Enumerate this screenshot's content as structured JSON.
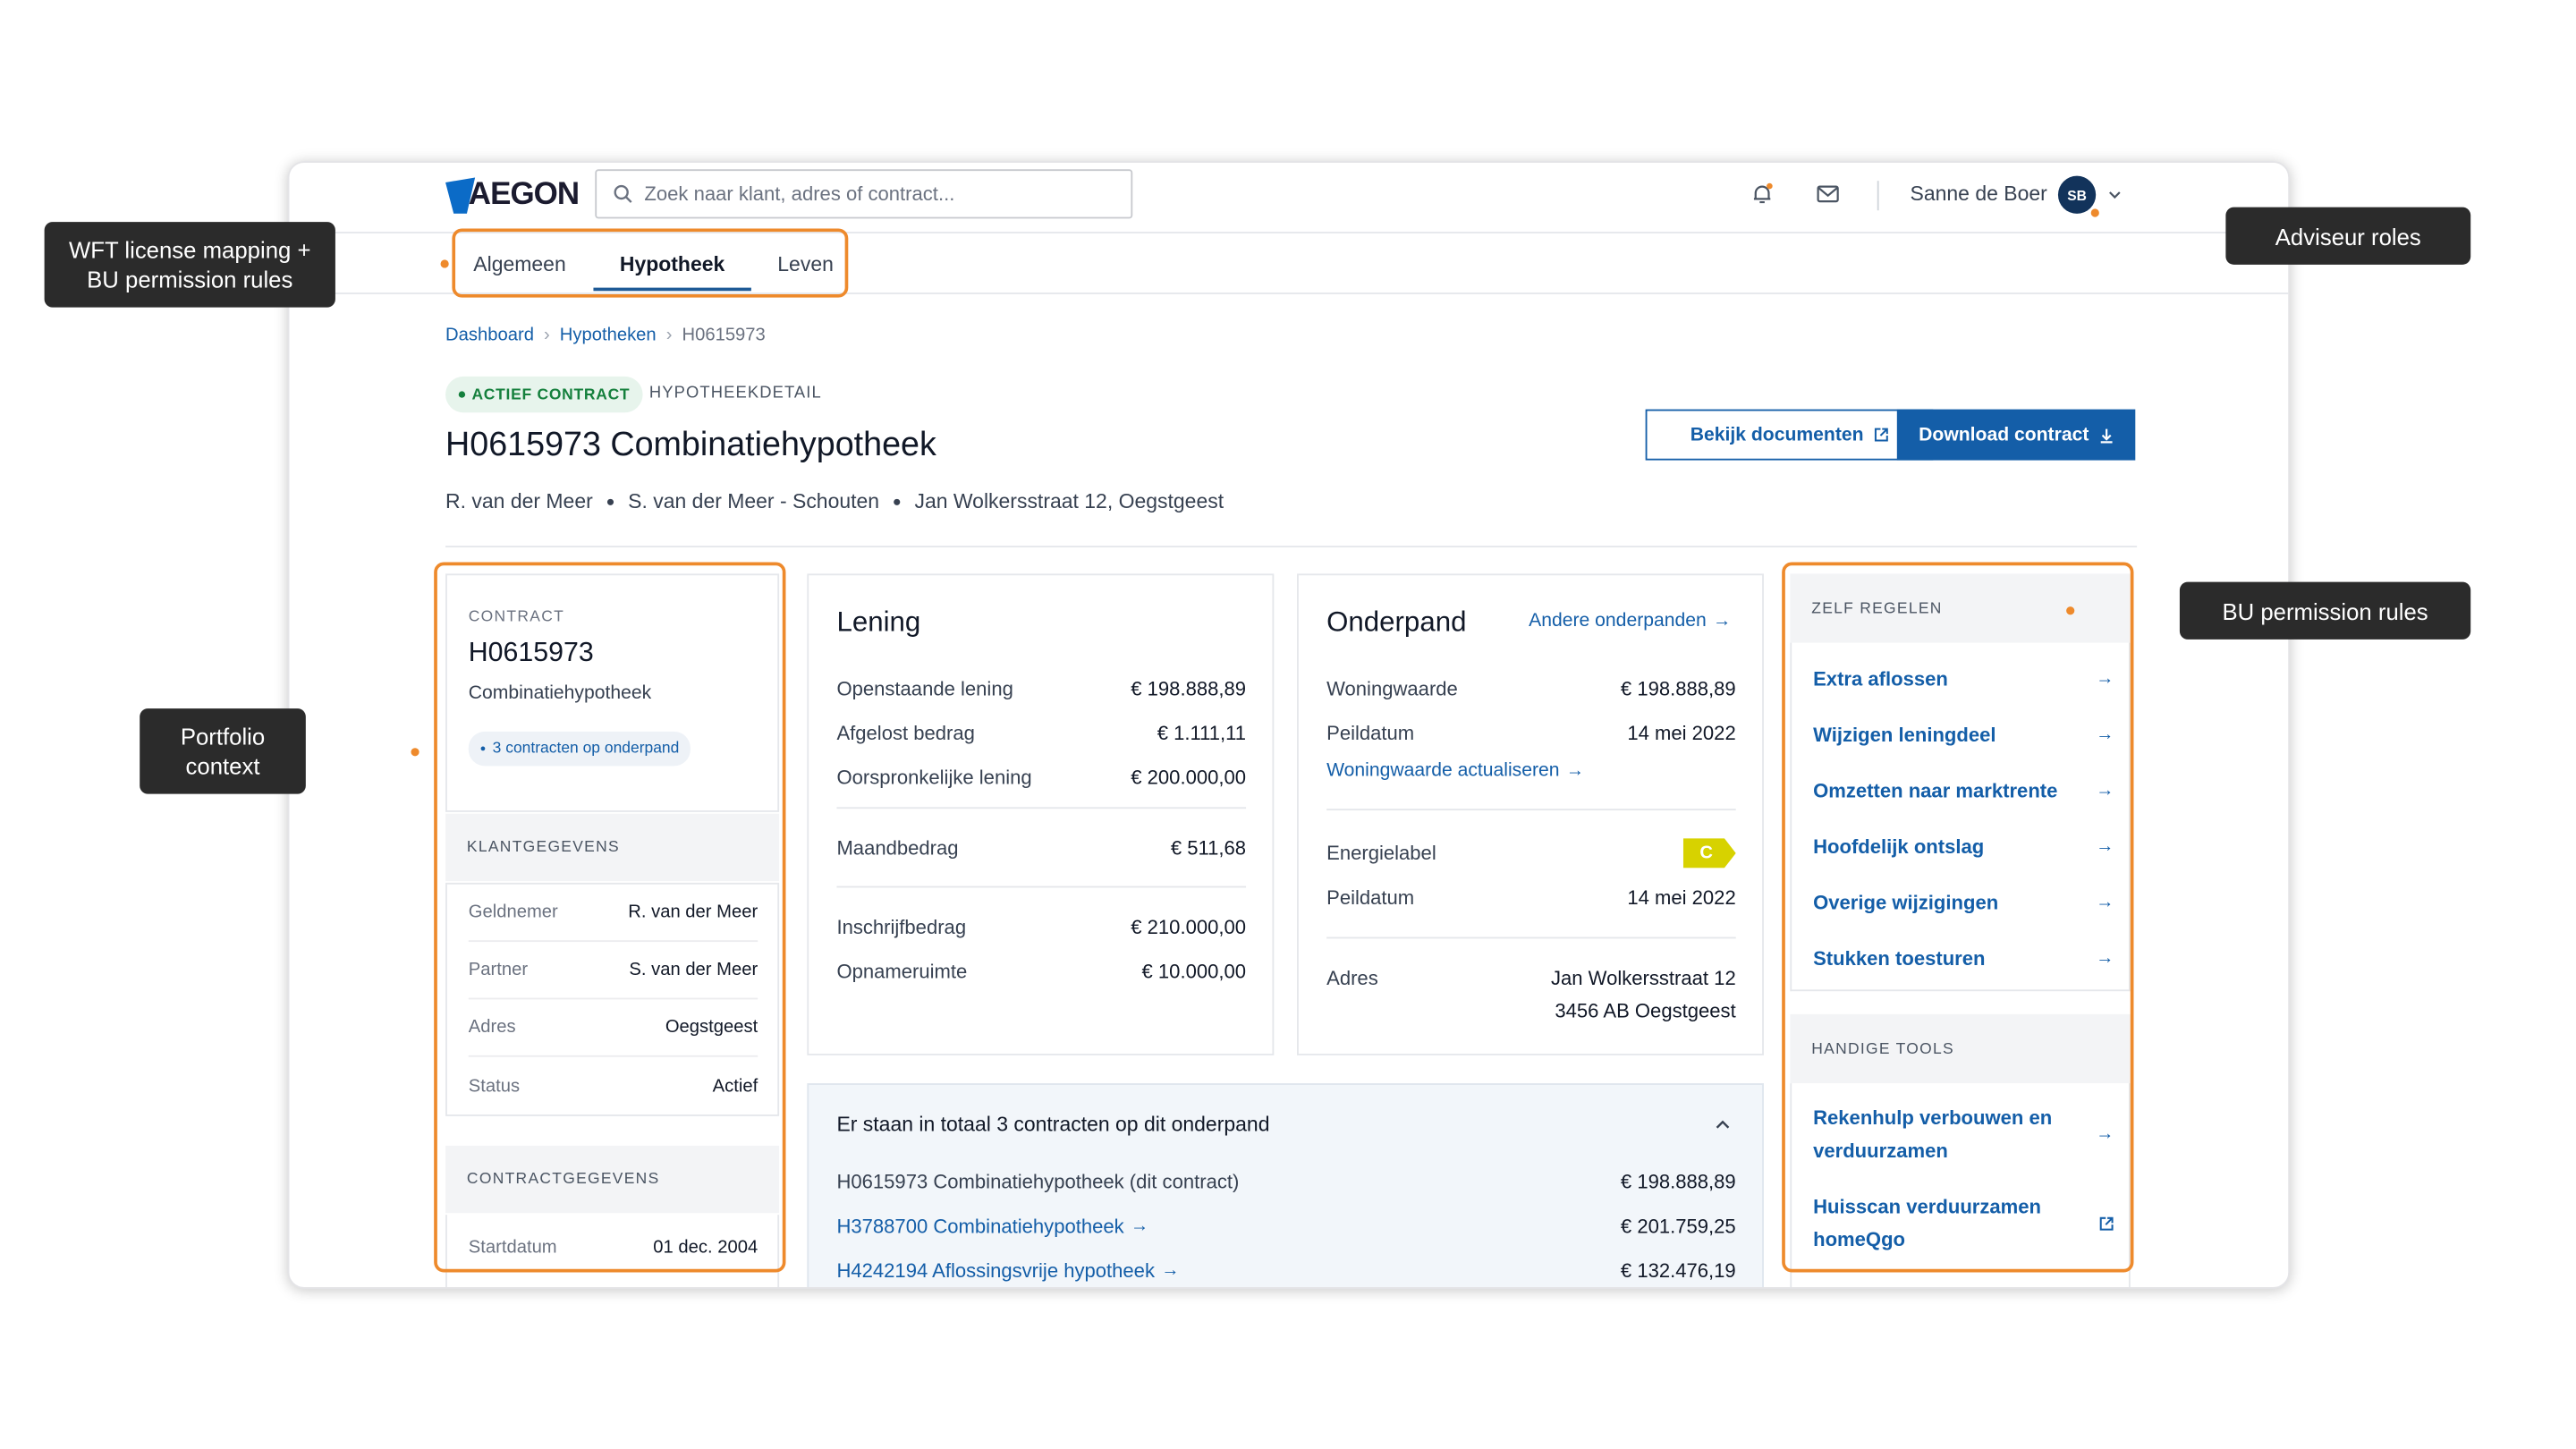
{
  "header": {
    "logo_text": "AEGON",
    "search_placeholder": "Zoek naar klant, adres of contract...",
    "user_name": "Sanne de Boer",
    "user_initials": "SB"
  },
  "tabs": [
    {
      "label": "Algemeen"
    },
    {
      "label": "Hypotheek",
      "active": true
    },
    {
      "label": "Leven"
    }
  ],
  "breadcrumb": {
    "home": "Dashboard",
    "section": "Hypotheken",
    "current": "H0615973"
  },
  "page": {
    "status_badge": "ACTIEF CONTRACT",
    "eyebrow": "HYPOTHEEKDETAIL",
    "title": "H0615973 Combinatiehypotheek",
    "subline": [
      "R. van der Meer",
      "S. van der Meer - Schouten",
      "Jan Wolkersstraat 12, Oegstgeest"
    ],
    "btn_documents": "Bekijk documenten",
    "btn_download": "Download contract"
  },
  "left_panel": {
    "contract_label": "CONTRACT",
    "contract_id": "H0615973",
    "contract_type": "Combinatiehypotheek",
    "contracts_pill": "3 contracten op onderpand",
    "klant_header": "KLANTGEGEVENS",
    "klant_rows": [
      {
        "label": "Geldnemer",
        "value": "R. van der Meer"
      },
      {
        "label": "Partner",
        "value": "S. van der Meer"
      },
      {
        "label": "Adres",
        "value": "Oegstgeest"
      },
      {
        "label": "Status",
        "value": "Actief"
      }
    ],
    "contract_header": "CONTRACTGEGEVENS",
    "contract_rows": [
      {
        "label": "Startdatum",
        "value": "01 dec. 2004"
      }
    ]
  },
  "lening": {
    "title": "Lening",
    "rows1": [
      {
        "label": "Openstaande lening",
        "value": "€ 198.888,89"
      },
      {
        "label": "Afgelost bedrag",
        "value": "€ 1.111,11"
      },
      {
        "label": "Oorspronkelijke lening",
        "value": "€ 200.000,00"
      }
    ],
    "rows2": [
      {
        "label": "Maandbedrag",
        "value": "€ 511,68"
      }
    ],
    "rows3": [
      {
        "label": "Inschrijfbedrag",
        "value": "€ 210.000,00"
      },
      {
        "label": "Opnameruimte",
        "value": "€ 10.000,00"
      }
    ]
  },
  "onderpand": {
    "title": "Onderpand",
    "other_link": "Andere onderpanden",
    "rows1": [
      {
        "label": "Woningwaarde",
        "value": "€ 198.888,89"
      },
      {
        "label": "Peildatum",
        "value": "14 mei 2022"
      }
    ],
    "update_link": "Woningwaarde actualiseren",
    "energy_label": "Energielabel",
    "energy_value": "C",
    "energy_peil_label": "Peildatum",
    "energy_peil_value": "14 mei 2022",
    "address_label": "Adres",
    "address_line1": "Jan Wolkersstraat 12",
    "address_line2": "3456 AB Oegstgeest"
  },
  "contracts_panel": {
    "title": "Er staan in totaal 3 contracten op dit onderpand",
    "rows": [
      {
        "label": "H0615973 Combinatiehypotheek (dit contract)",
        "value": "€ 198.888,89"
      },
      {
        "label": "H3788700 Combinatiehypotheek",
        "value": "€ 201.759,25"
      },
      {
        "label": "H4242194 Aflossingsvrije hypotheek",
        "value": "€ 132.476,19"
      }
    ]
  },
  "right_panel": {
    "zelf_header": "ZELF REGELEN",
    "zelf_items": [
      "Extra aflossen",
      "Wijzigen leningdeel",
      "Omzetten naar marktrente",
      "Hoofdelijk ontslag",
      "Overige wijzigingen",
      "Stukken toesturen"
    ],
    "tools_header": "HANDIGE TOOLS",
    "tools_items": [
      {
        "line1": "Rekenhulp verbouwen en",
        "line2": "verduurzamen"
      },
      {
        "line1": "Huisscan verduurzamen",
        "line2": "homeQgo"
      }
    ]
  },
  "annotations": {
    "wft": [
      "WFT license mapping +",
      "BU permission rules"
    ],
    "adviseur": "Adviseur roles",
    "portfolio": [
      "Portfolio",
      "context"
    ],
    "bu": "BU permission rules"
  },
  "colors": {
    "accent": "#145ea8",
    "annotation": "#ee8a2c",
    "callout_bg": "#2b2b2b",
    "active_green": "#15803d",
    "energy_c": "#d7d200"
  }
}
